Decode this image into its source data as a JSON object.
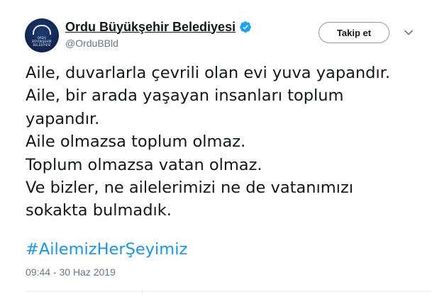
{
  "author": {
    "display_name": "Ordu Büyükşehir Belediyesi",
    "handle": "@OrduBBld",
    "verified": true,
    "avatar_text_line1": "ORDU",
    "avatar_text_line2": "BÜYÜKŞEHİR",
    "avatar_text_line3": "BELEDİYESİ"
  },
  "actions": {
    "follow_label": "Takip et",
    "more_icon": "chevron-down-icon"
  },
  "tweet": {
    "lines": [
      "Aile, duvarlarla çevrili olan evi yuva yapandır.",
      "Aile, bir arada yaşayan insanları toplum",
      "yapandır.",
      "Aile olmazsa toplum olmaz.",
      "Toplum olmazsa vatan olmaz.",
      "Ve bizler, ne ailelerimizi ne de vatanımızı",
      "sokakta bulmadık."
    ],
    "hashtag": "#AilemizHerŞeyimiz",
    "timestamp": "09:44 - 30 Haz 2019"
  },
  "colors": {
    "link": "#1b95e0",
    "verified": "#1da1f2",
    "secondary_text": "#657786",
    "primary_text": "#14171a"
  }
}
